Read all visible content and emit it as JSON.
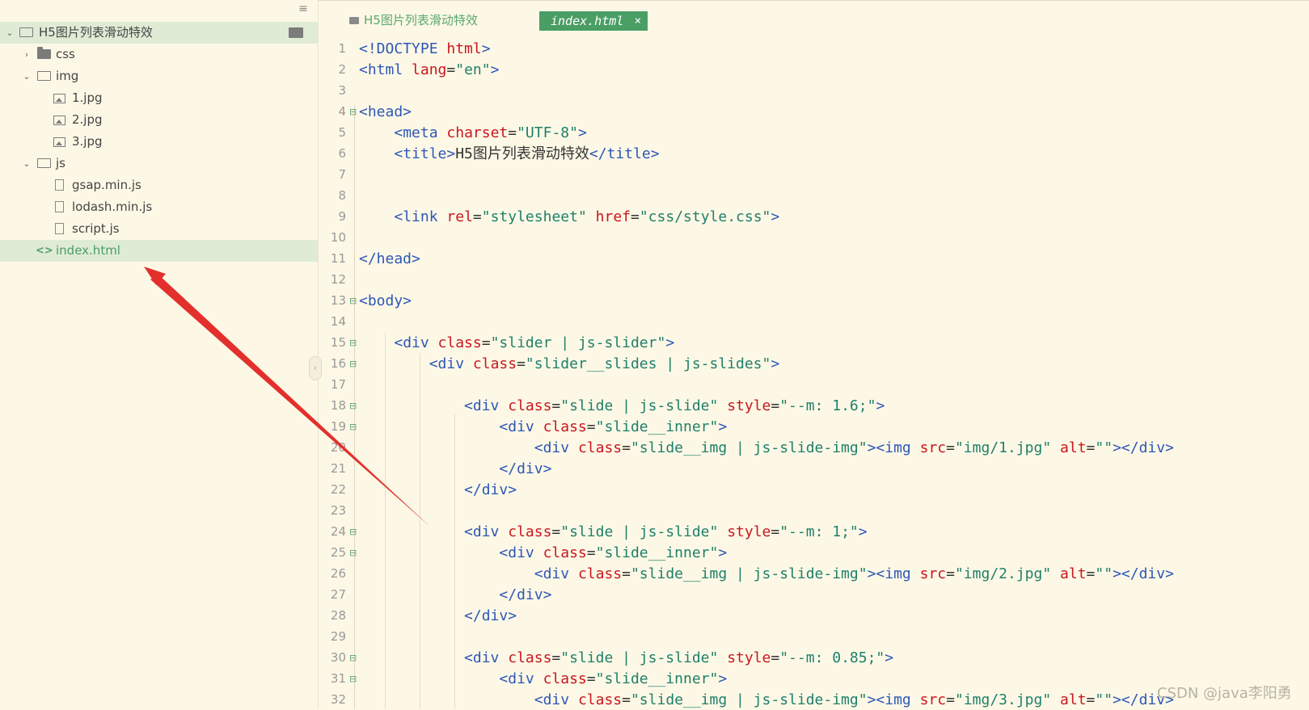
{
  "sidebar": {
    "menu_icon": "hamburger-menu-icon",
    "project": {
      "label": "H5图片列表滑动特效"
    },
    "items": [
      {
        "label": "css",
        "kind": "folder"
      },
      {
        "label": "img",
        "kind": "folder-open"
      },
      {
        "label": "1.jpg",
        "kind": "image"
      },
      {
        "label": "2.jpg",
        "kind": "image"
      },
      {
        "label": "3.jpg",
        "kind": "image"
      },
      {
        "label": "js",
        "kind": "folder-open"
      },
      {
        "label": "gsap.min.js",
        "kind": "file"
      },
      {
        "label": "lodash.min.js",
        "kind": "file"
      },
      {
        "label": "script.js",
        "kind": "file"
      },
      {
        "label": "index.html",
        "kind": "html"
      }
    ],
    "collapse_glyph": "‹"
  },
  "tabs": [
    {
      "label": "H5图片列表滑动特效"
    },
    {
      "label": "index.html",
      "close": "×"
    }
  ],
  "editor": {
    "lines": [
      [
        [
          "t-tag",
          "<!DOCTYPE "
        ],
        [
          "t-attr",
          "html"
        ],
        [
          "t-tag",
          ">"
        ]
      ],
      [
        [
          "t-tag",
          "<html "
        ],
        [
          "t-attr",
          "lang"
        ],
        [
          "t-txt",
          "="
        ],
        [
          "t-val",
          "\"en\""
        ],
        [
          "t-tag",
          ">"
        ]
      ],
      [],
      [
        [
          "t-tag",
          "<head>"
        ]
      ],
      [
        [
          "t-txt",
          "    "
        ],
        [
          "t-tag",
          "<meta "
        ],
        [
          "t-attr",
          "charset"
        ],
        [
          "t-txt",
          "="
        ],
        [
          "t-val",
          "\"UTF-8\""
        ],
        [
          "t-tag",
          ">"
        ]
      ],
      [
        [
          "t-txt",
          "    "
        ],
        [
          "t-tag",
          "<title>"
        ],
        [
          "t-txt",
          "H5图片列表滑动特效"
        ],
        [
          "t-tag",
          "</title>"
        ]
      ],
      [],
      [],
      [
        [
          "t-txt",
          "    "
        ],
        [
          "t-tag",
          "<link "
        ],
        [
          "t-attr",
          "rel"
        ],
        [
          "t-txt",
          "="
        ],
        [
          "t-val",
          "\"stylesheet\""
        ],
        [
          "t-txt",
          " "
        ],
        [
          "t-attr",
          "href"
        ],
        [
          "t-txt",
          "="
        ],
        [
          "t-val",
          "\"css/style.css\""
        ],
        [
          "t-tag",
          ">"
        ]
      ],
      [],
      [
        [
          "t-tag",
          "</head>"
        ]
      ],
      [],
      [
        [
          "t-tag",
          "<body>"
        ]
      ],
      [],
      [
        [
          "t-txt",
          "    "
        ],
        [
          "t-tag",
          "<div "
        ],
        [
          "t-attr",
          "class"
        ],
        [
          "t-txt",
          "="
        ],
        [
          "t-val",
          "\"slider | js-slider\""
        ],
        [
          "t-tag",
          ">"
        ]
      ],
      [
        [
          "t-txt",
          "        "
        ],
        [
          "t-tag",
          "<div "
        ],
        [
          "t-attr",
          "class"
        ],
        [
          "t-txt",
          "="
        ],
        [
          "t-val",
          "\"slider__slides | js-slides\""
        ],
        [
          "t-tag",
          ">"
        ]
      ],
      [],
      [
        [
          "t-txt",
          "            "
        ],
        [
          "t-tag",
          "<div "
        ],
        [
          "t-attr",
          "class"
        ],
        [
          "t-txt",
          "="
        ],
        [
          "t-val",
          "\"slide | js-slide\""
        ],
        [
          "t-txt",
          " "
        ],
        [
          "t-attr",
          "style"
        ],
        [
          "t-txt",
          "="
        ],
        [
          "t-val",
          "\"--m: 1.6;\""
        ],
        [
          "t-tag",
          ">"
        ]
      ],
      [
        [
          "t-txt",
          "                "
        ],
        [
          "t-tag",
          "<div "
        ],
        [
          "t-attr",
          "class"
        ],
        [
          "t-txt",
          "="
        ],
        [
          "t-val",
          "\"slide__inner\""
        ],
        [
          "t-tag",
          ">"
        ]
      ],
      [
        [
          "t-txt",
          "                    "
        ],
        [
          "t-tag",
          "<div "
        ],
        [
          "t-attr",
          "class"
        ],
        [
          "t-txt",
          "="
        ],
        [
          "t-val",
          "\"slide__img | js-slide-img\""
        ],
        [
          "t-tag",
          "><img "
        ],
        [
          "t-attr",
          "src"
        ],
        [
          "t-txt",
          "="
        ],
        [
          "t-val",
          "\"img/1.jpg\""
        ],
        [
          "t-txt",
          " "
        ],
        [
          "t-attr",
          "alt"
        ],
        [
          "t-txt",
          "="
        ],
        [
          "t-val",
          "\"\""
        ],
        [
          "t-tag",
          "></div>"
        ]
      ],
      [
        [
          "t-txt",
          "                "
        ],
        [
          "t-tag",
          "</div>"
        ]
      ],
      [
        [
          "t-txt",
          "            "
        ],
        [
          "t-tag",
          "</div>"
        ]
      ],
      [],
      [
        [
          "t-txt",
          "            "
        ],
        [
          "t-tag",
          "<div "
        ],
        [
          "t-attr",
          "class"
        ],
        [
          "t-txt",
          "="
        ],
        [
          "t-val",
          "\"slide | js-slide\""
        ],
        [
          "t-txt",
          " "
        ],
        [
          "t-attr",
          "style"
        ],
        [
          "t-txt",
          "="
        ],
        [
          "t-val",
          "\"--m: 1;\""
        ],
        [
          "t-tag",
          ">"
        ]
      ],
      [
        [
          "t-txt",
          "                "
        ],
        [
          "t-tag",
          "<div "
        ],
        [
          "t-attr",
          "class"
        ],
        [
          "t-txt",
          "="
        ],
        [
          "t-val",
          "\"slide__inner\""
        ],
        [
          "t-tag",
          ">"
        ]
      ],
      [
        [
          "t-txt",
          "                    "
        ],
        [
          "t-tag",
          "<div "
        ],
        [
          "t-attr",
          "class"
        ],
        [
          "t-txt",
          "="
        ],
        [
          "t-val",
          "\"slide__img | js-slide-img\""
        ],
        [
          "t-tag",
          "><img "
        ],
        [
          "t-attr",
          "src"
        ],
        [
          "t-txt",
          "="
        ],
        [
          "t-val",
          "\"img/2.jpg\""
        ],
        [
          "t-txt",
          " "
        ],
        [
          "t-attr",
          "alt"
        ],
        [
          "t-txt",
          "="
        ],
        [
          "t-val",
          "\"\""
        ],
        [
          "t-tag",
          "></div>"
        ]
      ],
      [
        [
          "t-txt",
          "                "
        ],
        [
          "t-tag",
          "</div>"
        ]
      ],
      [
        [
          "t-txt",
          "            "
        ],
        [
          "t-tag",
          "</div>"
        ]
      ],
      [],
      [
        [
          "t-txt",
          "            "
        ],
        [
          "t-tag",
          "<div "
        ],
        [
          "t-attr",
          "class"
        ],
        [
          "t-txt",
          "="
        ],
        [
          "t-val",
          "\"slide | js-slide\""
        ],
        [
          "t-txt",
          " "
        ],
        [
          "t-attr",
          "style"
        ],
        [
          "t-txt",
          "="
        ],
        [
          "t-val",
          "\"--m: 0.85;\""
        ],
        [
          "t-tag",
          ">"
        ]
      ],
      [
        [
          "t-txt",
          "                "
        ],
        [
          "t-tag",
          "<div "
        ],
        [
          "t-attr",
          "class"
        ],
        [
          "t-txt",
          "="
        ],
        [
          "t-val",
          "\"slide__inner\""
        ],
        [
          "t-tag",
          ">"
        ]
      ],
      [
        [
          "t-txt",
          "                    "
        ],
        [
          "t-tag",
          "<div "
        ],
        [
          "t-attr",
          "class"
        ],
        [
          "t-txt",
          "="
        ],
        [
          "t-val",
          "\"slide__img | js-slide-img\""
        ],
        [
          "t-tag",
          "><img "
        ],
        [
          "t-attr",
          "src"
        ],
        [
          "t-txt",
          "="
        ],
        [
          "t-val",
          "\"img/3.jpg\""
        ],
        [
          "t-txt",
          " "
        ],
        [
          "t-attr",
          "alt"
        ],
        [
          "t-txt",
          "="
        ],
        [
          "t-val",
          "\"\""
        ],
        [
          "t-tag",
          "></div>"
        ]
      ]
    ],
    "foldable_lines": [
      4,
      13,
      15,
      16,
      18,
      19,
      24,
      25,
      30,
      31
    ]
  },
  "annotation": {
    "type": "red-arrow",
    "points_to": "index.html"
  },
  "watermark": "CSDN @java李阳勇",
  "colors": {
    "background": "#fdf8e6",
    "accent": "#4a9e64",
    "selection": "#e0ebd6",
    "tag": "#2d57b7",
    "attr": "#c9161e",
    "value": "#1f7f6b",
    "arrow": "#e3302c"
  }
}
